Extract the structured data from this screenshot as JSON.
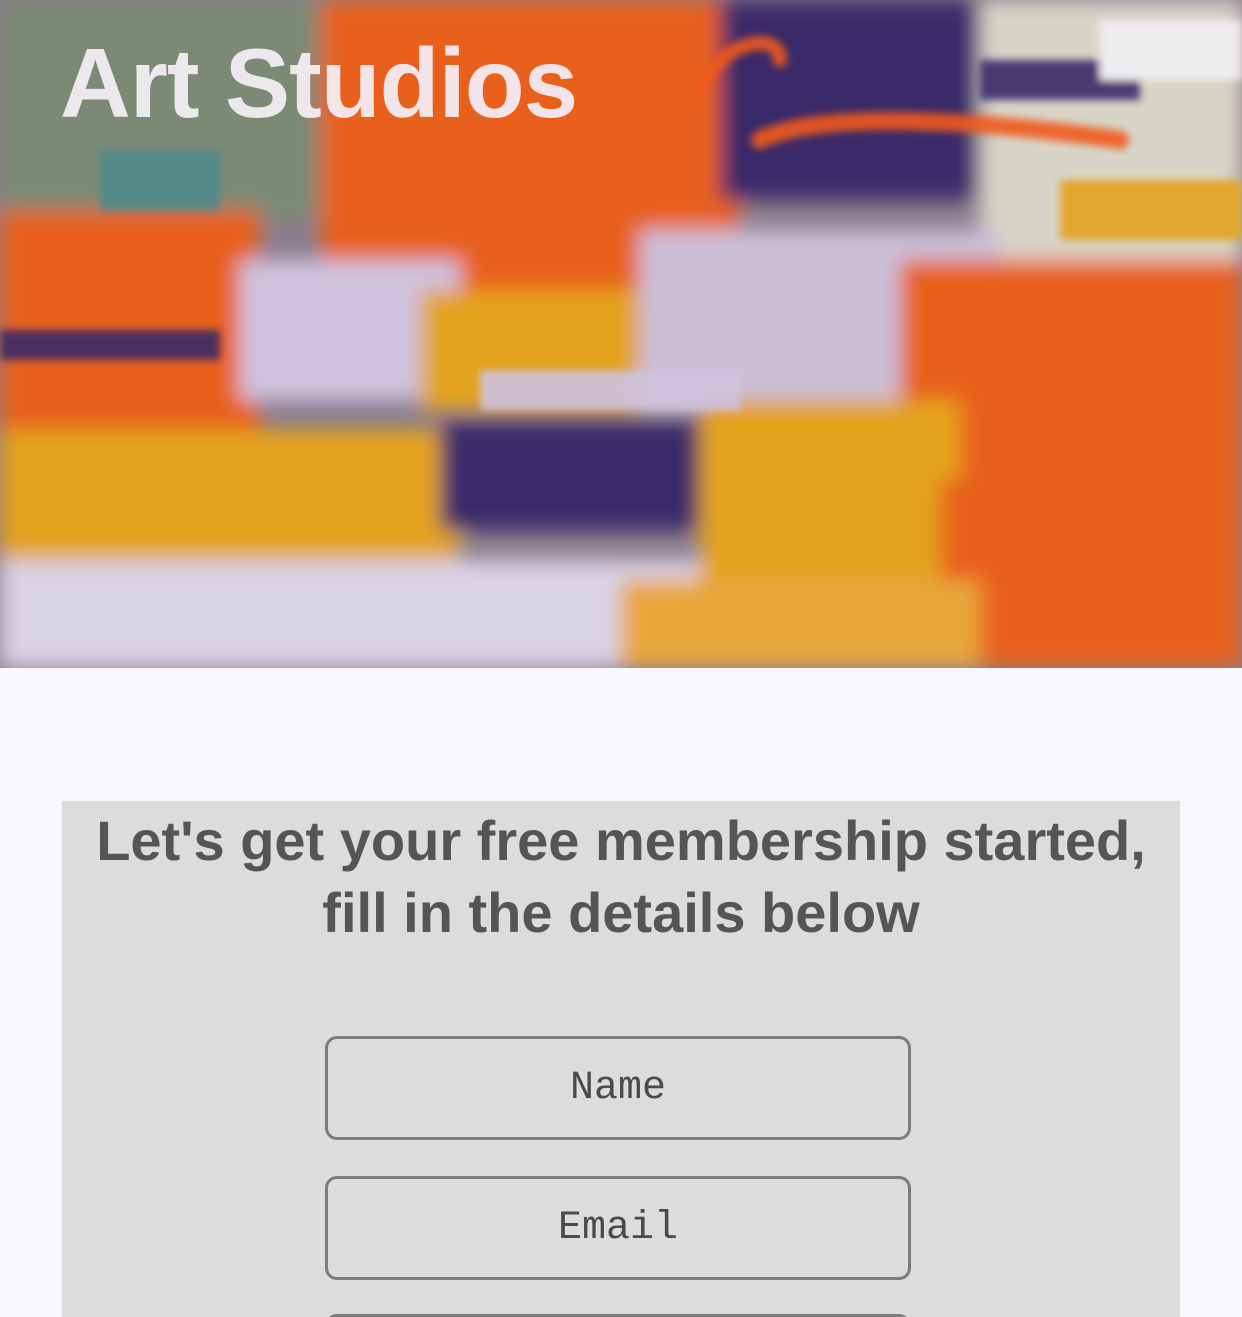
{
  "hero": {
    "title": "Art Studios",
    "image": "abstract-oil-paint-texture",
    "palette": [
      "#e8611e",
      "#e3a21f",
      "#3a2a6b",
      "#d9d3e6",
      "#4f8a8b"
    ]
  },
  "signup": {
    "heading": "Let's get your free membership started, fill in the details below",
    "fields": {
      "name_placeholder": "Name",
      "email_placeholder": "Email"
    }
  },
  "colors": {
    "page_background": "#f8f7fd",
    "card_background": "#dcdcdc",
    "text": "#555456",
    "field_border": "#7c7c7c"
  }
}
